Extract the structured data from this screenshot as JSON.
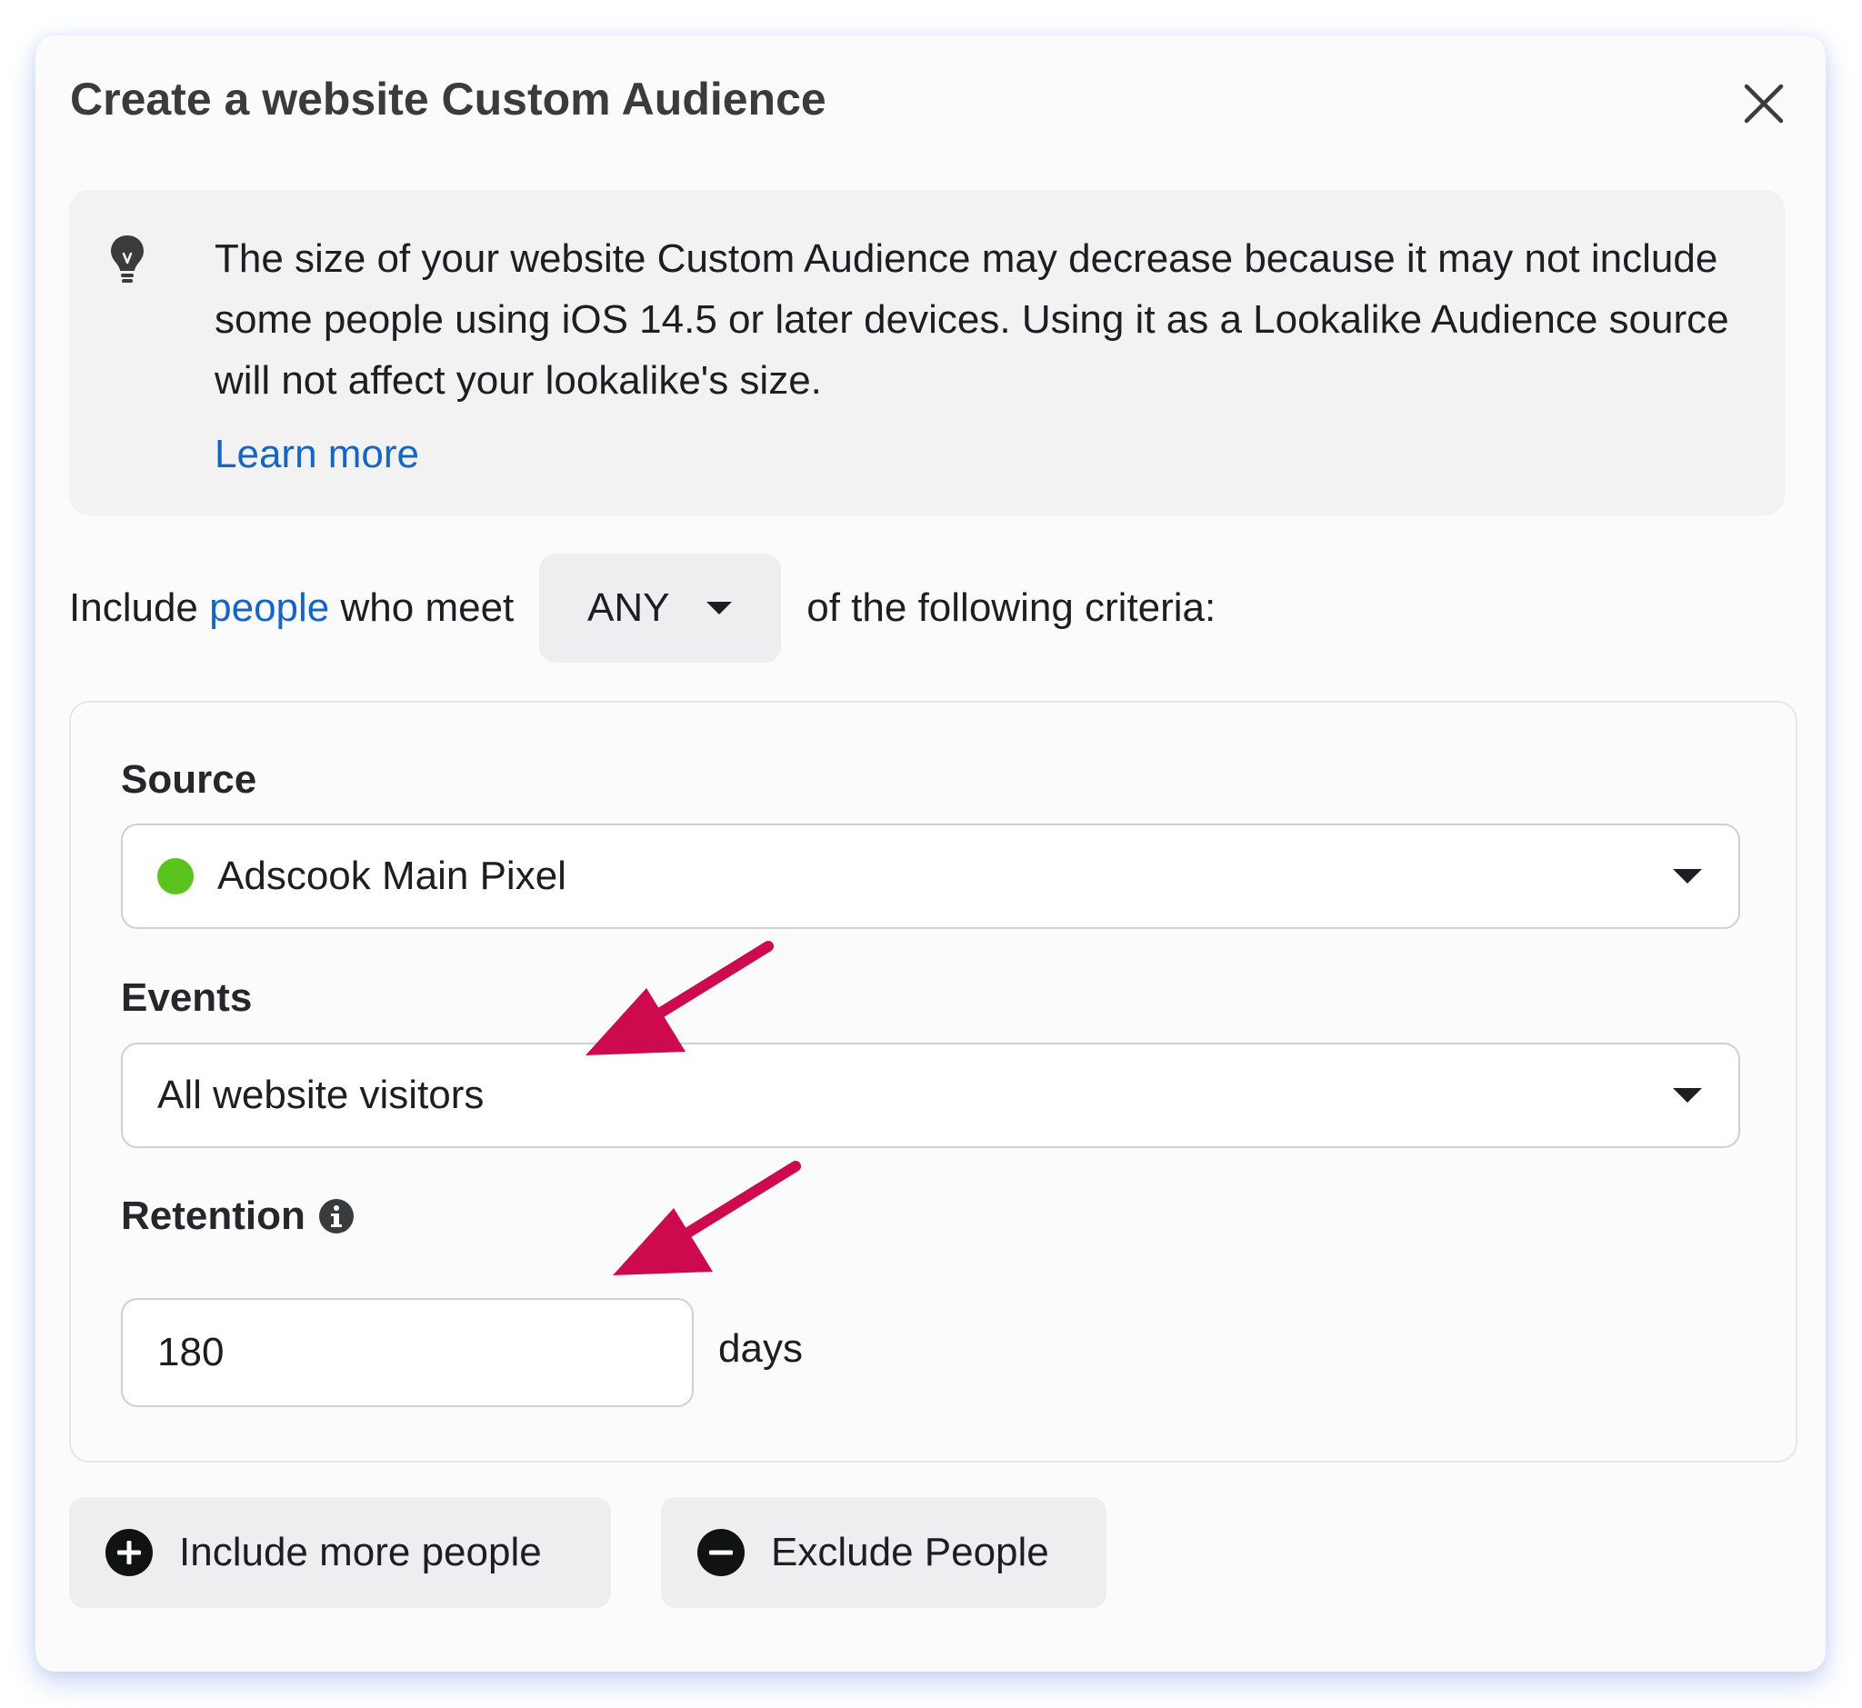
{
  "dialog": {
    "title": "Create a website Custom Audience"
  },
  "notice": {
    "icon": "lightbulb-icon",
    "text": "The size of your website Custom Audience may decrease because it may not include some people using iOS 14.5 or later devices. Using it as a Lookalike Audience source will not affect your lookalike's size.",
    "link_label": "Learn more"
  },
  "criteria": {
    "prefix": "Include",
    "link": "people",
    "middle": "who meet",
    "match_value": "ANY",
    "suffix": "of the following criteria:"
  },
  "source": {
    "label": "Source",
    "value": "Adscook Main Pixel",
    "status_color": "#5ac31e"
  },
  "events": {
    "label": "Events",
    "value": "All website visitors"
  },
  "retention": {
    "label": "Retention",
    "value": "180",
    "unit": "days"
  },
  "actions": {
    "include_label": "Include more people",
    "exclude_label": "Exclude People"
  },
  "colors": {
    "link": "#1565c7",
    "annotation_arrow": "#cc0a4d"
  }
}
